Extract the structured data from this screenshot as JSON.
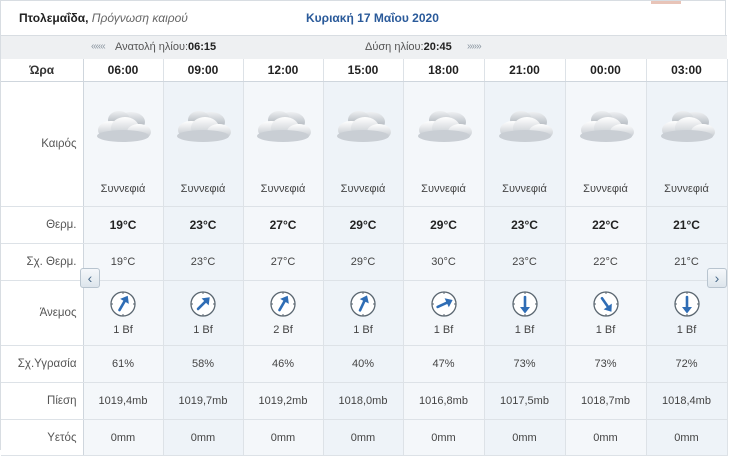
{
  "header": {
    "location": "Πτολεμαΐδα,",
    "subtitle": "Πρόγνωση καιρού",
    "date": "Κυριακή 17 Μαΐου 2020"
  },
  "sun": {
    "left_chevrons": "«««",
    "sunrise_label": "Ανατολή ηλίου:",
    "sunrise": "06:15",
    "sunset_label": "Δύση ηλίου:",
    "sunset": "20:45",
    "right_chevrons": "»»»"
  },
  "labels": {
    "hour": "Ώρα",
    "weather": "Καιρός",
    "temp": "Θερμ.",
    "feels": "Σχ. Θερμ.",
    "wind": "Άνεμος",
    "humidity": "Σχ.Υγρασία",
    "pressure": "Πίεση",
    "rain": "Υετός"
  },
  "nav": {
    "prev": "‹",
    "next": "›"
  },
  "forecast": [
    {
      "hour": "06:00",
      "icon": "cloudy-icon",
      "desc": "Συννεφιά",
      "temp": "19°C",
      "feels": "19°C",
      "wind_dir": 30,
      "wind": "1 Bf",
      "humidity": "61%",
      "pressure": "1019,4mb",
      "rain": "0mm"
    },
    {
      "hour": "09:00",
      "icon": "cloudy-icon",
      "desc": "Συννεφιά",
      "temp": "23°C",
      "feels": "23°C",
      "wind_dir": 45,
      "wind": "1 Bf",
      "humidity": "58%",
      "pressure": "1019,7mb",
      "rain": "0mm"
    },
    {
      "hour": "12:00",
      "icon": "cloudy-icon",
      "desc": "Συννεφιά",
      "temp": "27°C",
      "feels": "27°C",
      "wind_dir": 30,
      "wind": "2 Bf",
      "humidity": "46%",
      "pressure": "1019,2mb",
      "rain": "0mm"
    },
    {
      "hour": "15:00",
      "icon": "cloudy-icon",
      "desc": "Συννεφιά",
      "temp": "29°C",
      "feels": "29°C",
      "wind_dir": 25,
      "wind": "1 Bf",
      "humidity": "40%",
      "pressure": "1018,0mb",
      "rain": "0mm"
    },
    {
      "hour": "18:00",
      "icon": "cloudy-icon",
      "desc": "Συννεφιά",
      "temp": "29°C",
      "feels": "30°C",
      "wind_dir": 65,
      "wind": "1 Bf",
      "humidity": "47%",
      "pressure": "1016,8mb",
      "rain": "0mm"
    },
    {
      "hour": "21:00",
      "icon": "cloudy-icon",
      "desc": "Συννεφιά",
      "temp": "23°C",
      "feels": "23°C",
      "wind_dir": 180,
      "wind": "1 Bf",
      "humidity": "73%",
      "pressure": "1017,5mb",
      "rain": "0mm"
    },
    {
      "hour": "00:00",
      "icon": "cloudy-icon",
      "desc": "Συννεφιά",
      "temp": "22°C",
      "feels": "22°C",
      "wind_dir": 145,
      "wind": "1 Bf",
      "humidity": "73%",
      "pressure": "1018,7mb",
      "rain": "0mm"
    },
    {
      "hour": "03:00",
      "icon": "cloudy-icon",
      "desc": "Συννεφιά",
      "temp": "21°C",
      "feels": "21°C",
      "wind_dir": 180,
      "wind": "1 Bf",
      "humidity": "72%",
      "pressure": "1018,4mb",
      "rain": "0mm"
    }
  ],
  "colors": {
    "accent": "#2a5a9a",
    "arrow": "#2f6db5",
    "cell": "#f4f7fa",
    "border": "#dde2e7"
  }
}
